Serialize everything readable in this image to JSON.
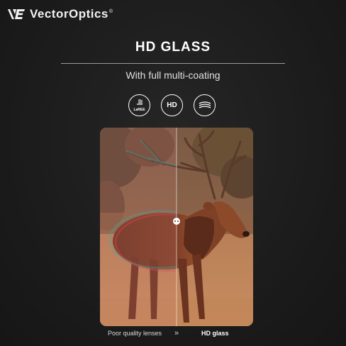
{
  "brand": {
    "logo_mark": "VE",
    "name": "VectorOptics",
    "trademark": "®"
  },
  "heading": {
    "title": "HD GLASS",
    "subtitle": "With full multi-coating"
  },
  "badges": [
    {
      "icon": "laree-icon",
      "label": "LaREE"
    },
    {
      "icon": "hd-icon",
      "label": "HD"
    },
    {
      "icon": "multi-coating-icon",
      "label": ""
    }
  ],
  "comparison": {
    "left_caption": "Poor quality lenses",
    "arrow": "»",
    "right_caption": "HD glass",
    "subject": "red deer stag in a field"
  },
  "colors": {
    "background": "#1c1c1c",
    "text": "#ffffff",
    "rule": "#9a9a9a"
  }
}
